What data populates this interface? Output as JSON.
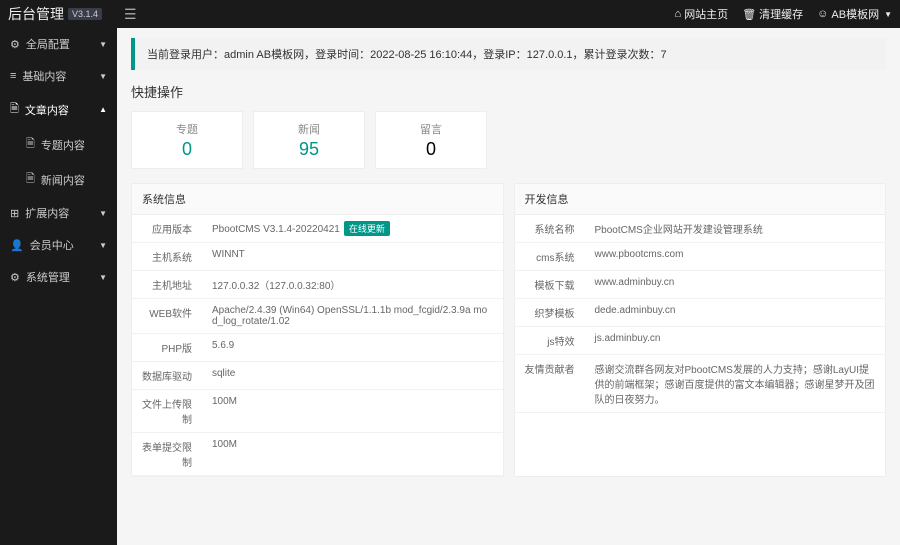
{
  "topbar": {
    "brand": "后台管理",
    "version": "V3.1.4",
    "links": {
      "home": "网站主页",
      "clear_cache": "清理缓存",
      "user": "AB模板网"
    }
  },
  "sidebar": {
    "items": [
      {
        "icon": "⚙",
        "label": "全局配置",
        "expanded": false
      },
      {
        "icon": "≡",
        "label": "基础内容",
        "expanded": false
      },
      {
        "icon": "🗎",
        "label": "文章内容",
        "expanded": true
      },
      {
        "icon": "⬚",
        "label": "扩展内容",
        "expanded": false
      },
      {
        "icon": "👤",
        "label": "会员中心",
        "expanded": false
      },
      {
        "icon": "⚙",
        "label": "系统管理",
        "expanded": false
      }
    ],
    "subs": [
      {
        "icon": "🗎",
        "label": "专题内容"
      },
      {
        "icon": "🗎",
        "label": "新闻内容"
      }
    ]
  },
  "info_bar": {
    "prefix": "当前登录用户：",
    "user": "admin AB模板网",
    "login_time_label": "，登录时间：",
    "login_time": "2022-08-25 16:10:44",
    "login_ip_label": "，登录IP：",
    "login_ip": "127.0.0.1",
    "count_label": "，累计登录次数：",
    "count": "7"
  },
  "quick_title": "快捷操作",
  "stats": [
    {
      "label": "专题",
      "value": "0",
      "color": "teal"
    },
    {
      "label": "新闻",
      "value": "95",
      "color": "teal"
    },
    {
      "label": "留言",
      "value": "0",
      "color": "black"
    }
  ],
  "panels": {
    "sys": {
      "title": "系统信息",
      "rows": [
        {
          "k": "应用版本",
          "v": "PbootCMS V3.1.4-20220421",
          "badge": "在线更新"
        },
        {
          "k": "主机系统",
          "v": "WINNT"
        },
        {
          "k": "主机地址",
          "v": "127.0.0.32（127.0.0.32:80）"
        },
        {
          "k": "WEB软件",
          "v": "Apache/2.4.39 (Win64) OpenSSL/1.1.1b mod_fcgid/2.3.9a mod_log_rotate/1.02"
        },
        {
          "k": "PHP版",
          "v": "5.6.9"
        },
        {
          "k": "数据库驱动",
          "v": "sqlite"
        },
        {
          "k": "文件上传限制",
          "v": "100M"
        },
        {
          "k": "表单提交限制",
          "v": "100M"
        }
      ]
    },
    "dev": {
      "title": "开发信息",
      "rows": [
        {
          "k": "系统名称",
          "v": "PbootCMS企业网站开发建设管理系统"
        },
        {
          "k": "cms系统",
          "v": "www.pbootcms.com"
        },
        {
          "k": "模板下载",
          "v": "www.adminbuy.cn"
        },
        {
          "k": "织梦模板",
          "v": "dede.adminbuy.cn"
        },
        {
          "k": "js特效",
          "v": "js.adminbuy.cn"
        },
        {
          "k": "友情贡献者",
          "v": "感谢交流群各网友对PbootCMS发展的人力支持；感谢LayUI提供的前端框架；感谢百度提供的富文本编辑器；感谢星梦开及团队的日夜努力。"
        }
      ]
    }
  }
}
